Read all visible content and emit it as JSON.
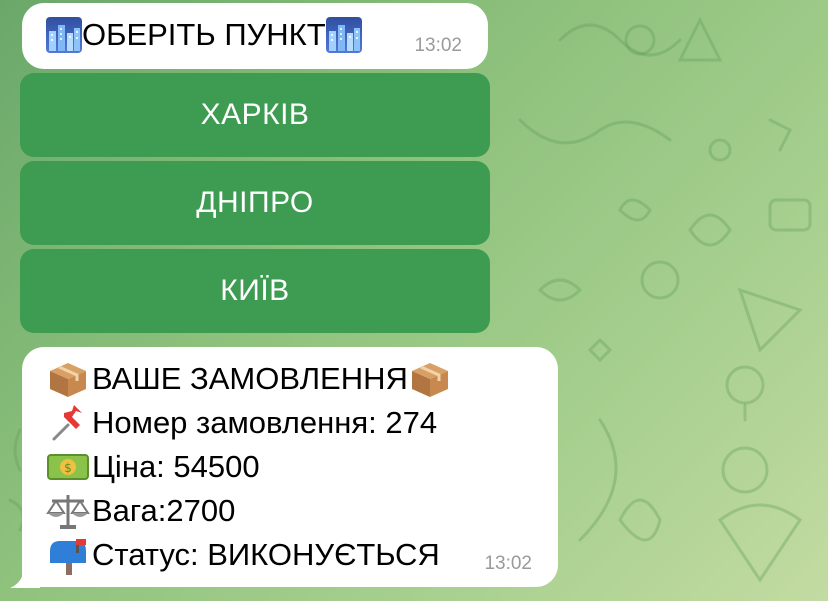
{
  "messages": [
    {
      "text": "ОБЕРІТЬ ПУНКТ",
      "time": "13:02",
      "icon_left": "cityscape-icon",
      "icon_right": "cityscape-icon"
    },
    {
      "lines": [
        {
          "icon": "package-icon",
          "text": "ВАШЕ ЗАМОВЛЕННЯ",
          "icon_after": "package-icon"
        },
        {
          "icon": "pushpin-icon",
          "text": "Номер замовлення: 274"
        },
        {
          "icon": "money-icon",
          "text": "Ціна: 54500"
        },
        {
          "icon": "scales-icon",
          "text": "Вага:2700"
        },
        {
          "icon": "mailbox-icon",
          "text": "Статус: ВИКОНУЄТЬСЯ"
        }
      ],
      "time": "13:02"
    }
  ],
  "keyboard": {
    "buttons": [
      "ХАРКІВ",
      "ДНІПРО",
      "КИЇВ"
    ],
    "color": "#3e9b52"
  },
  "colors": {
    "background": "#8ec17c",
    "bubble": "#ffffff",
    "timestamp": "#9a9a9a"
  }
}
